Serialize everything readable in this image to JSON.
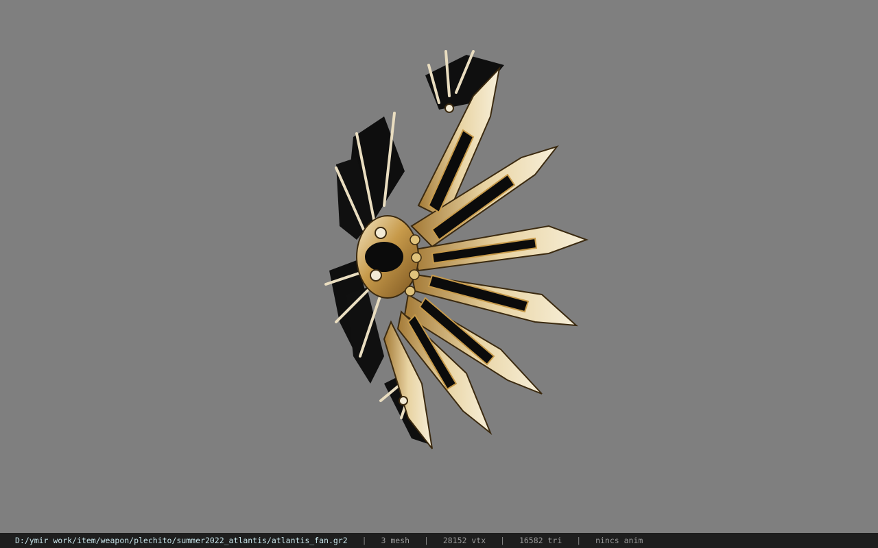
{
  "viewer": {
    "background_color": "#7f7f7f",
    "model_icon": "spiked-fan-weapon-model"
  },
  "status": {
    "path": "D:/ymir work/item/weapon/plechito/summer2022_atlantis/atlantis_fan.gr2",
    "separator": "|",
    "mesh": "3 mesh",
    "vtx": "28152 vtx",
    "tri": "16582 tri",
    "anim": "nincs anim"
  }
}
